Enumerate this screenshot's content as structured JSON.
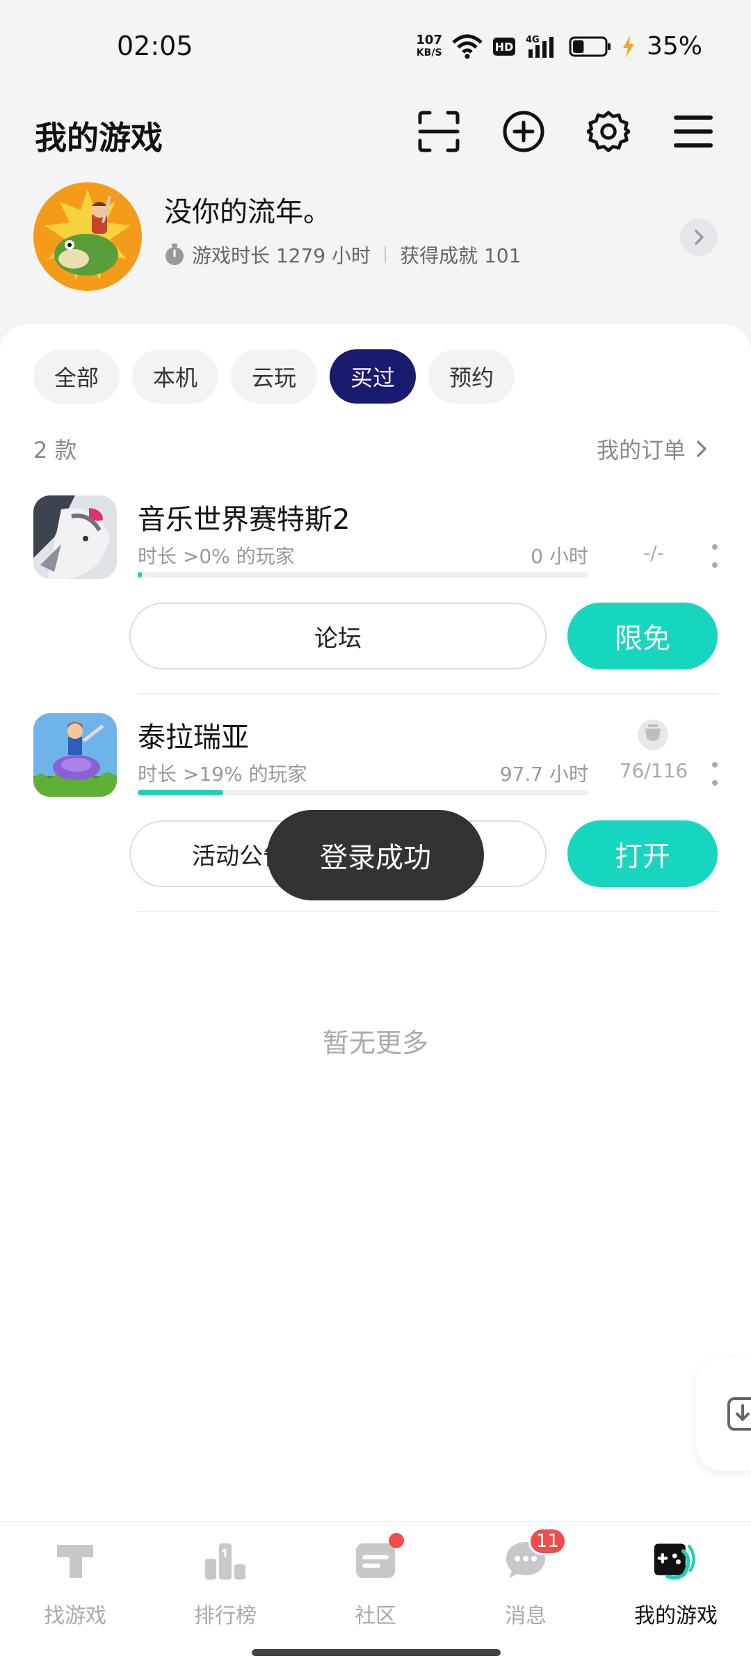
{
  "status_bar": {
    "time": "02:05",
    "net_speed_value": "107",
    "net_speed_unit": "KB/S",
    "hd": "HD",
    "network": "4G",
    "battery_percent": "35%",
    "battery_level": 0.35
  },
  "header": {
    "title": "我的游戏",
    "icons": [
      "scan-icon",
      "add-circle-icon",
      "gear-icon",
      "menu-icon"
    ]
  },
  "profile": {
    "username": "没你的流年。",
    "play_time": "游戏时长 1279 小时",
    "achievements": "获得成就 101"
  },
  "filters": {
    "items": [
      "全部",
      "本机",
      "云玩",
      "买过",
      "预约"
    ],
    "active_index": 3
  },
  "list_meta": {
    "count": "2 款",
    "orders_label": "我的订单"
  },
  "games": [
    {
      "name": "音乐世界赛特斯2",
      "subtitle": "时长 >0% 的玩家",
      "hours": "0 小时",
      "achievement": "-/-",
      "progress": 0.01,
      "secondary_button": "论坛",
      "primary_button": "限免"
    },
    {
      "name": "泰拉瑞亚",
      "subtitle": "时长 >19% 的玩家",
      "hours": "97.7 小时",
      "achievement": "76/116",
      "progress": 0.19,
      "secondary_button": "活动公告",
      "primary_button": "打开"
    }
  ],
  "no_more_text": "暂无更多",
  "toast": "登录成功",
  "bottom_nav": {
    "items": [
      {
        "label": "找游戏",
        "icon": "find-games-icon"
      },
      {
        "label": "排行榜",
        "icon": "leaderboard-icon"
      },
      {
        "label": "社区",
        "icon": "community-icon"
      },
      {
        "label": "消息",
        "icon": "message-icon",
        "badge": "11"
      },
      {
        "label": "我的游戏",
        "icon": "my-games-icon"
      }
    ],
    "active_index": 4
  },
  "colors": {
    "accent": "#17d6c0",
    "chip_active": "#1a1a6e",
    "badge": "#f24b4b"
  }
}
